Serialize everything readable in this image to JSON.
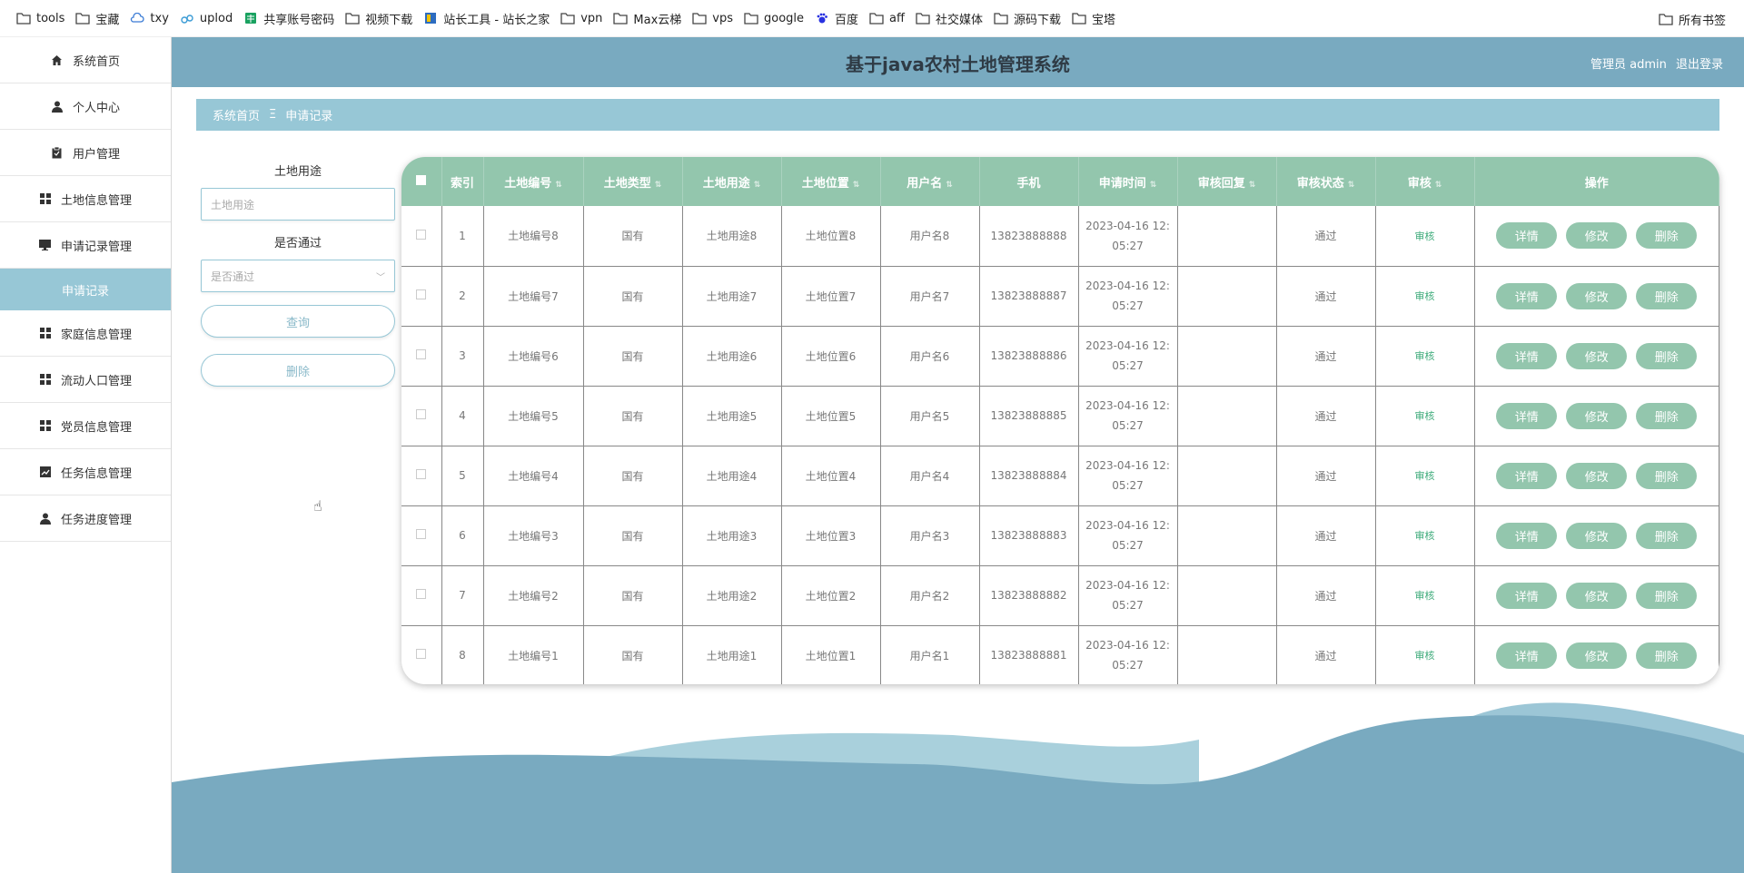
{
  "bookmarks": [
    {
      "label": "tools",
      "icon": "folder-icon"
    },
    {
      "label": "宝藏",
      "icon": "folder-icon"
    },
    {
      "label": "txy",
      "icon": "cloud-icon"
    },
    {
      "label": "uplod",
      "icon": "upload-icon"
    },
    {
      "label": "共享账号密码",
      "icon": "sheet-icon"
    },
    {
      "label": "视频下载",
      "icon": "folder-icon"
    },
    {
      "label": "站长工具 - 站长之家",
      "icon": "site-icon"
    },
    {
      "label": "vpn",
      "icon": "folder-icon"
    },
    {
      "label": "Max云梯",
      "icon": "folder-icon"
    },
    {
      "label": "vps",
      "icon": "folder-icon"
    },
    {
      "label": "google",
      "icon": "folder-icon"
    },
    {
      "label": "百度",
      "icon": "baidu-icon"
    },
    {
      "label": "aff",
      "icon": "folder-icon"
    },
    {
      "label": "社交媒体",
      "icon": "folder-icon"
    },
    {
      "label": "源码下载",
      "icon": "folder-icon"
    },
    {
      "label": "宝塔",
      "icon": "folder-icon"
    }
  ],
  "all_bookmarks": "所有书签",
  "sidebar": {
    "items": [
      {
        "label": "系统首页",
        "icon": "home-icon"
      },
      {
        "label": "个人中心",
        "icon": "person-icon"
      },
      {
        "label": "用户管理",
        "icon": "clipboard-icon"
      },
      {
        "label": "土地信息管理",
        "icon": "grid-icon"
      },
      {
        "label": "申请记录管理",
        "icon": "monitor-icon"
      },
      {
        "label": "申请记录",
        "icon": "",
        "active": true
      },
      {
        "label": "家庭信息管理",
        "icon": "grid-icon"
      },
      {
        "label": "流动人口管理",
        "icon": "grid-icon"
      },
      {
        "label": "党员信息管理",
        "icon": "grid-icon"
      },
      {
        "label": "任务信息管理",
        "icon": "chart-icon"
      },
      {
        "label": "任务进度管理",
        "icon": "person-icon"
      }
    ]
  },
  "header": {
    "title": "基于java农村土地管理系统",
    "user": "管理员 admin",
    "logout": "退出登录"
  },
  "breadcrumb": {
    "home": "系统首页",
    "sep": "Ξ",
    "current": "申请记录"
  },
  "search": {
    "land_use_label": "土地用途",
    "land_use_placeholder": "土地用途",
    "pass_label": "是否通过",
    "pass_placeholder": "是否通过",
    "query_button": "查询",
    "delete_button": "删除"
  },
  "table": {
    "columns": [
      "",
      "索引",
      "土地编号",
      "土地类型",
      "土地用途",
      "土地位置",
      "用户名",
      "手机",
      "申请时间",
      "审核回复",
      "审核状态",
      "审核",
      "操作"
    ],
    "rows": [
      {
        "index": "1",
        "land_no": "土地编号8",
        "type": "国有",
        "use": "土地用途8",
        "location": "土地位置8",
        "user": "用户名8",
        "phone": "13823888888",
        "time1": "2023-04-16 12:",
        "time2": "05:27",
        "reply": "",
        "status": "通过",
        "audit": "审核"
      },
      {
        "index": "2",
        "land_no": "土地编号7",
        "type": "国有",
        "use": "土地用途7",
        "location": "土地位置7",
        "user": "用户名7",
        "phone": "13823888887",
        "time1": "2023-04-16 12:",
        "time2": "05:27",
        "reply": "",
        "status": "通过",
        "audit": "审核"
      },
      {
        "index": "3",
        "land_no": "土地编号6",
        "type": "国有",
        "use": "土地用途6",
        "location": "土地位置6",
        "user": "用户名6",
        "phone": "13823888886",
        "time1": "2023-04-16 12:",
        "time2": "05:27",
        "reply": "",
        "status": "通过",
        "audit": "审核"
      },
      {
        "index": "4",
        "land_no": "土地编号5",
        "type": "国有",
        "use": "土地用途5",
        "location": "土地位置5",
        "user": "用户名5",
        "phone": "13823888885",
        "time1": "2023-04-16 12:",
        "time2": "05:27",
        "reply": "",
        "status": "通过",
        "audit": "审核"
      },
      {
        "index": "5",
        "land_no": "土地编号4",
        "type": "国有",
        "use": "土地用途4",
        "location": "土地位置4",
        "user": "用户名4",
        "phone": "13823888884",
        "time1": "2023-04-16 12:",
        "time2": "05:27",
        "reply": "",
        "status": "通过",
        "audit": "审核"
      },
      {
        "index": "6",
        "land_no": "土地编号3",
        "type": "国有",
        "use": "土地用途3",
        "location": "土地位置3",
        "user": "用户名3",
        "phone": "13823888883",
        "time1": "2023-04-16 12:",
        "time2": "05:27",
        "reply": "",
        "status": "通过",
        "audit": "审核"
      },
      {
        "index": "7",
        "land_no": "土地编号2",
        "type": "国有",
        "use": "土地用途2",
        "location": "土地位置2",
        "user": "用户名2",
        "phone": "13823888882",
        "time1": "2023-04-16 12:",
        "time2": "05:27",
        "reply": "",
        "status": "通过",
        "audit": "审核"
      },
      {
        "index": "8",
        "land_no": "土地编号1",
        "type": "国有",
        "use": "土地用途1",
        "location": "土地位置1",
        "user": "用户名1",
        "phone": "13823888881",
        "time1": "2023-04-16 12:",
        "time2": "05:27",
        "reply": "",
        "status": "通过",
        "audit": "审核"
      }
    ],
    "actions": {
      "detail": "详情",
      "edit": "修改",
      "delete": "删除"
    }
  },
  "colors": {
    "header": "#79aac0",
    "breadcrumb": "#97c7d6",
    "table_header": "#93c6ad",
    "audit_text": "#3dab7a"
  }
}
